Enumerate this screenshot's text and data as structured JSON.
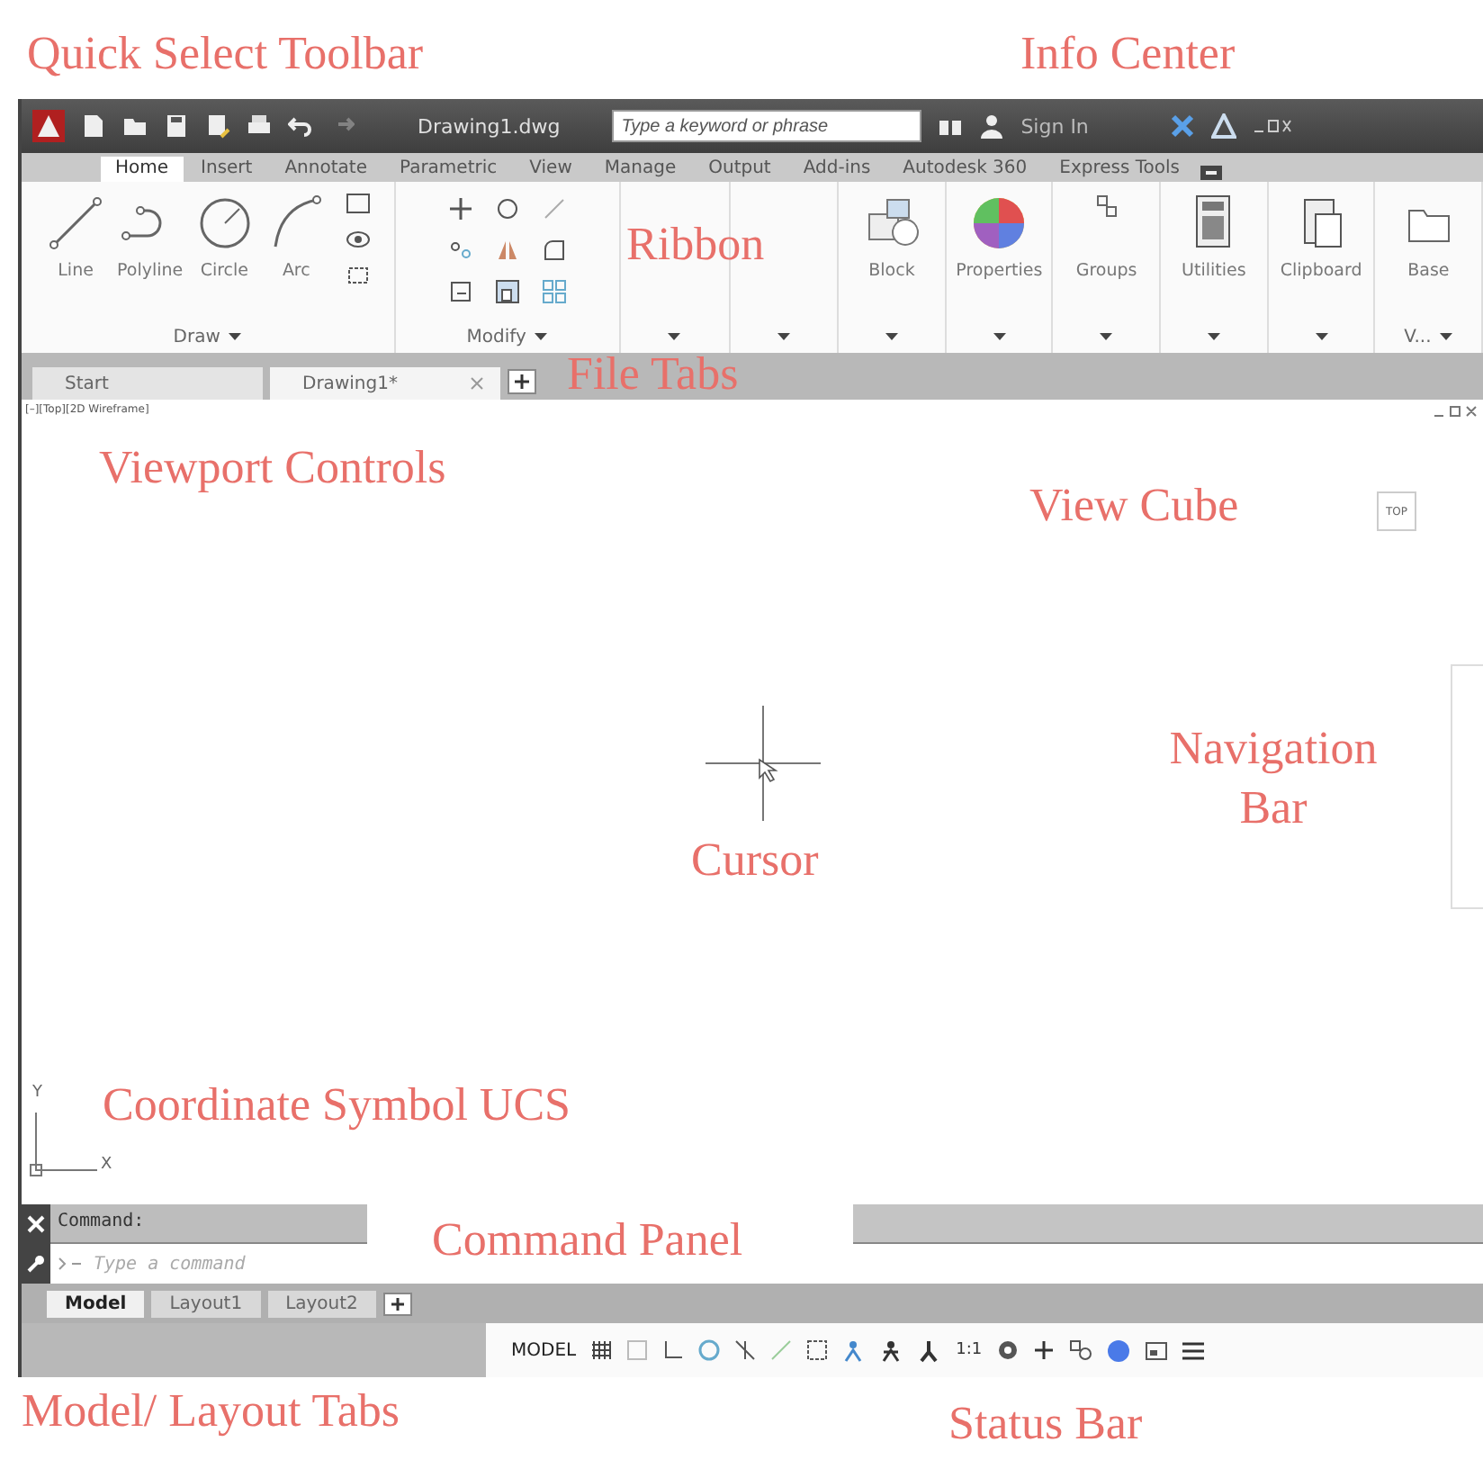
{
  "annotations": [
    {
      "text": "Quick Select Toolbar"
    },
    {
      "text": "Info Center"
    },
    {
      "text": "Ribbon"
    },
    {
      "text": "File Tabs"
    },
    {
      "text": "Viewport Controls"
    },
    {
      "text": "View Cube"
    },
    {
      "text": "Navigation Bar"
    },
    {
      "text": "Cursor"
    },
    {
      "text": "Coordinate Symbol UCS"
    },
    {
      "text": "Command Panel"
    },
    {
      "text": "Model/ Layout Tabs"
    },
    {
      "text": "Status Bar"
    }
  ],
  "title_bar": {
    "file_name": "Drawing1.dwg",
    "search": {
      "placeholder": "Type a keyword or phrase"
    },
    "sign_in": "Sign In"
  },
  "ribbon_tabs": [
    {
      "label": "Home",
      "selected": true
    },
    {
      "label": "Insert",
      "selected": false
    },
    {
      "label": "Annotate",
      "selected": false
    },
    {
      "label": "Parametric",
      "selected": false
    },
    {
      "label": "View",
      "selected": false
    },
    {
      "label": "Manage",
      "selected": false
    },
    {
      "label": "Output",
      "selected": false
    },
    {
      "label": "Add-ins",
      "selected": false
    },
    {
      "label": "Autodesk 360",
      "selected": false
    },
    {
      "label": "Express Tools",
      "selected": false
    }
  ],
  "ribbon_panels": [
    {
      "kind": "draw",
      "title": "Draw",
      "tools": [
        {
          "kind": "line",
          "label": "Line"
        },
        {
          "kind": "polyline",
          "label": "Polyline"
        },
        {
          "kind": "circle",
          "label": "Circle"
        },
        {
          "kind": "arc",
          "label": "Arc"
        }
      ]
    },
    {
      "kind": "modify",
      "title": "Modify"
    },
    {
      "kind": "blank"
    },
    {
      "kind": "blank"
    },
    {
      "kind": "tool",
      "tools": [
        {
          "kind": "block",
          "label": "Block"
        }
      ]
    },
    {
      "kind": "tool",
      "tools": [
        {
          "kind": "properties",
          "label": "Properties"
        }
      ]
    },
    {
      "kind": "tool",
      "tools": [
        {
          "kind": "groups",
          "label": "Groups"
        }
      ]
    },
    {
      "kind": "tool",
      "tools": [
        {
          "kind": "utilities",
          "label": "Utilities"
        }
      ]
    },
    {
      "kind": "tool",
      "tools": [
        {
          "kind": "clipboard",
          "label": "Clipboard"
        }
      ]
    },
    {
      "kind": "tool",
      "title": "V...",
      "tools": [
        {
          "kind": "base",
          "label": "Base"
        }
      ]
    }
  ],
  "file_tabs": [
    {
      "label": "Start",
      "selected": false,
      "closable": false
    },
    {
      "label": "Drawing1*",
      "selected": true,
      "closable": true
    }
  ],
  "viewport_controls": "[–][Top][2D Wireframe]",
  "view_cube": {
    "face": "TOP"
  },
  "ucs": {
    "y_label": "Y",
    "x_label": "X"
  },
  "command": {
    "history": "Command:",
    "placeholder": "Type a command"
  },
  "layout_tabs": [
    {
      "label": "Model",
      "selected": true
    },
    {
      "label": "Layout1",
      "selected": false
    },
    {
      "label": "Layout2",
      "selected": false
    }
  ],
  "status_bar": {
    "mode": "MODEL",
    "scale": "1:1"
  }
}
